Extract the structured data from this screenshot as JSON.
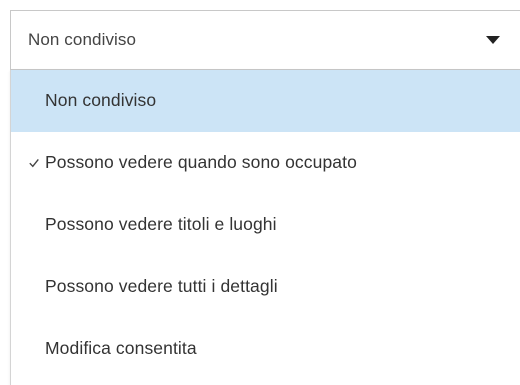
{
  "dropdown": {
    "selected_value": "Non condiviso",
    "arrow_icon": "caret-down-icon"
  },
  "menu": {
    "items": [
      {
        "label": "Non condiviso",
        "highlighted": true,
        "checked": false
      },
      {
        "label": "Possono vedere quando sono occupato",
        "highlighted": false,
        "checked": true
      },
      {
        "label": "Possono vedere titoli e luoghi",
        "highlighted": false,
        "checked": false
      },
      {
        "label": "Possono vedere tutti i dettagli",
        "highlighted": false,
        "checked": false
      },
      {
        "label": "Modifica consentita",
        "highlighted": false,
        "checked": false
      }
    ],
    "check_icon": "checkmark-icon",
    "highlight_color": "#cce4f6"
  }
}
